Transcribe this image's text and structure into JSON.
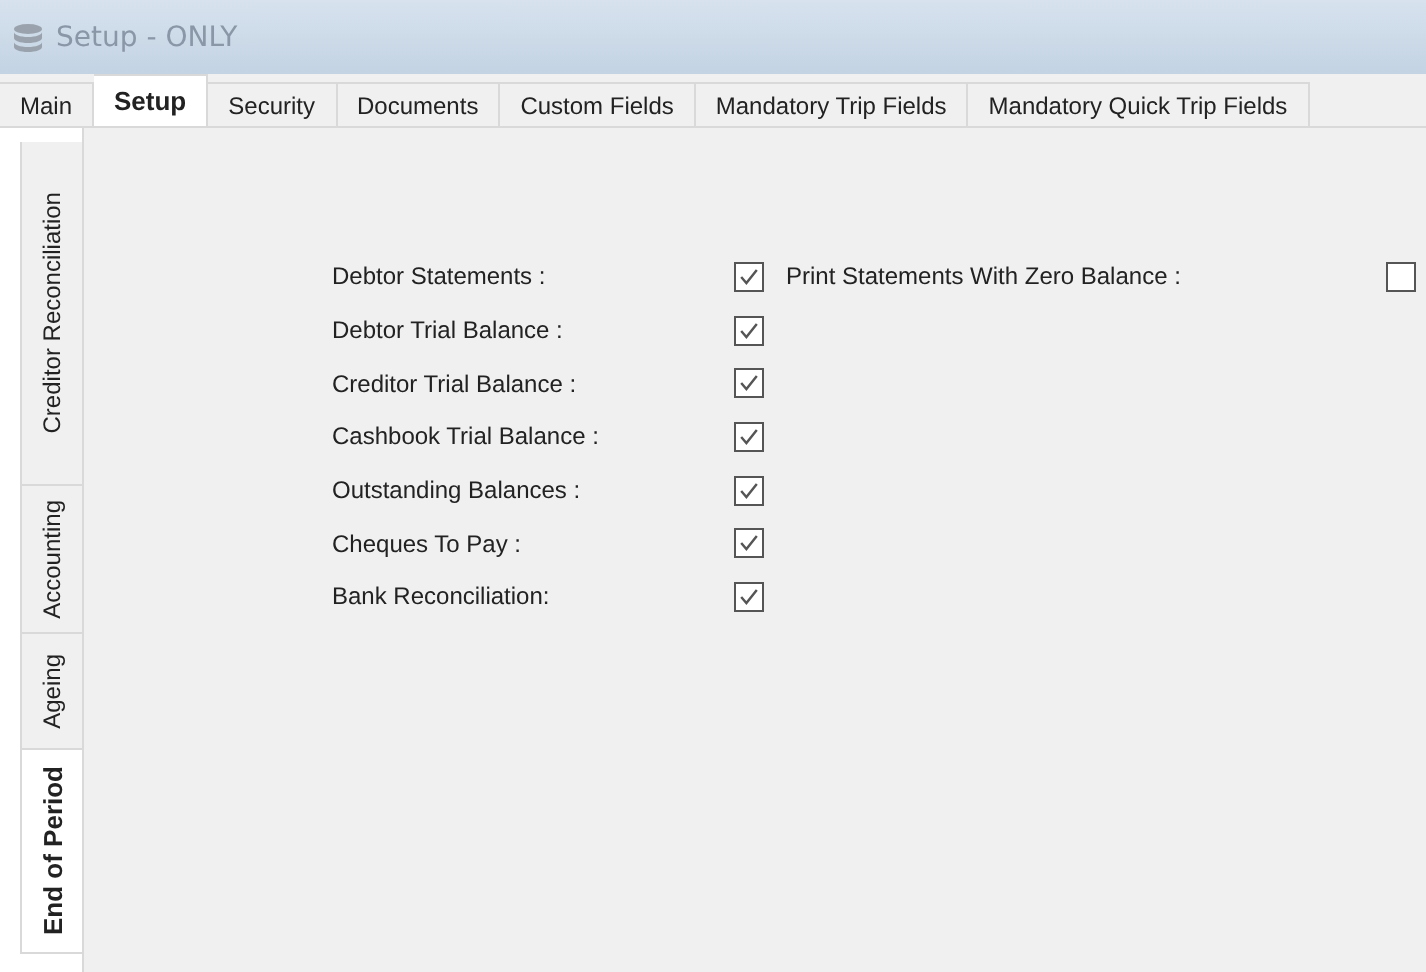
{
  "window": {
    "title": "Setup - ONLY"
  },
  "tabs": [
    {
      "label": "Main",
      "selected": false
    },
    {
      "label": "Setup",
      "selected": true
    },
    {
      "label": "Security",
      "selected": false
    },
    {
      "label": "Documents",
      "selected": false
    },
    {
      "label": "Custom Fields",
      "selected": false
    },
    {
      "label": "Mandatory Trip Fields",
      "selected": false
    },
    {
      "label": "Mandatory Quick Trip Fields",
      "selected": false
    }
  ],
  "side_tabs": [
    {
      "label": "Creditor Reconciliation",
      "selected": false
    },
    {
      "label": "Accounting",
      "selected": false
    },
    {
      "label": "Ageing",
      "selected": false
    },
    {
      "label": "End of Period",
      "selected": true
    }
  ],
  "options": [
    {
      "label": "Debtor Statements :",
      "checked": true,
      "extra": {
        "label": "Print Statements With Zero Balance :",
        "checked": false
      }
    },
    {
      "label": "Debtor Trial Balance :",
      "checked": true
    },
    {
      "label": "Creditor Trial Balance :",
      "checked": true
    },
    {
      "label": "Cashbook Trial Balance :",
      "checked": true
    },
    {
      "label": "Outstanding Balances :",
      "checked": true
    },
    {
      "label": "Cheques To Pay :",
      "checked": true
    },
    {
      "label": "Bank Reconciliation:",
      "checked": true
    }
  ]
}
